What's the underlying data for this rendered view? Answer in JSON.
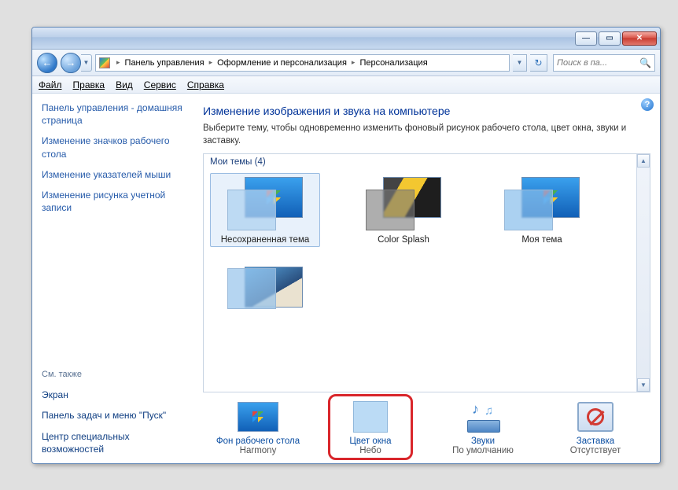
{
  "win": {
    "min": "—",
    "max": "▭",
    "close": "✕"
  },
  "breadcrumbs": {
    "b1": "Панель управления",
    "b2": "Оформление и персонализация",
    "b3": "Персонализация"
  },
  "search": {
    "placeholder": "Поиск в па..."
  },
  "menus": {
    "file": "Файл",
    "edit": "Правка",
    "view": "Вид",
    "tools": "Сервис",
    "help": "Справка"
  },
  "sidebar": {
    "home": "Панель управления - домашняя страница",
    "icons": "Изменение значков рабочего стола",
    "pointers": "Изменение указателей мыши",
    "account_pic": "Изменение рисунка учетной записи",
    "see_also": "См. также",
    "display": "Экран",
    "taskbar": "Панель задач и меню \"Пуск\"",
    "ease": "Центр специальных возможностей"
  },
  "main": {
    "title": "Изменение изображения и звука на компьютере",
    "subtitle": "Выберите тему, чтобы одновременно изменить фоновый рисунок рабочего стола, цвет окна, звуки и заставку.",
    "themes_header": "Мои темы (4)",
    "themes": {
      "t1": "Несохраненная тема",
      "t2": "Color Splash",
      "t3": "Моя тема",
      "t4": ""
    }
  },
  "actions": {
    "bg": {
      "label": "Фон рабочего стола",
      "value": "Harmony"
    },
    "color": {
      "label": "Цвет окна",
      "value": "Небо"
    },
    "sounds": {
      "label": "Звуки",
      "value": "По умолчанию"
    },
    "saver": {
      "label": "Заставка",
      "value": "Отсутствует"
    }
  }
}
